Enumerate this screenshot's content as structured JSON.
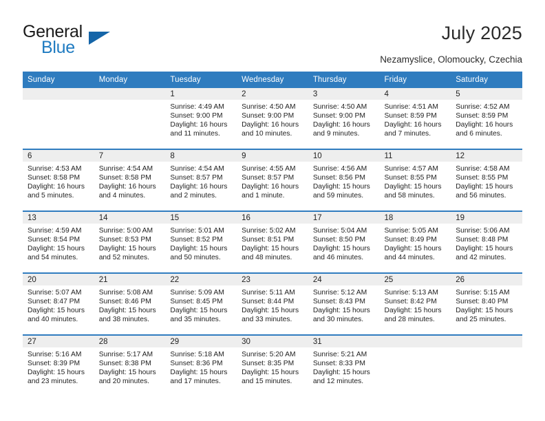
{
  "brand": {
    "word_one": "General",
    "word_two": "Blue",
    "triangle_icon": "brand-triangle-icon",
    "accent_color": "#1f7bc1",
    "triangle_color": "#1565a8"
  },
  "header": {
    "title": "July 2025",
    "subtitle": "Nezamyslice, Olomoucky, Czechia"
  },
  "theme": {
    "header_bg": "#2f7cbf",
    "header_text": "#ffffff",
    "date_strip_bg": "#eeeeee",
    "row_divider": "#2f7cbf",
    "body_text": "#222222"
  },
  "calendar": {
    "weekday_headers": [
      "Sunday",
      "Monday",
      "Tuesday",
      "Wednesday",
      "Thursday",
      "Friday",
      "Saturday"
    ],
    "labels": {
      "sunrise": "Sunrise:",
      "sunset": "Sunset:",
      "daylight": "Daylight:"
    },
    "weeks": [
      [
        {
          "day": "",
          "empty": true
        },
        {
          "day": "",
          "empty": true
        },
        {
          "day": "1",
          "sunrise": "Sunrise: 4:49 AM",
          "sunset": "Sunset: 9:00 PM",
          "daylight_1": "Daylight: 16 hours",
          "daylight_2": "and 11 minutes."
        },
        {
          "day": "2",
          "sunrise": "Sunrise: 4:50 AM",
          "sunset": "Sunset: 9:00 PM",
          "daylight_1": "Daylight: 16 hours",
          "daylight_2": "and 10 minutes."
        },
        {
          "day": "3",
          "sunrise": "Sunrise: 4:50 AM",
          "sunset": "Sunset: 9:00 PM",
          "daylight_1": "Daylight: 16 hours",
          "daylight_2": "and 9 minutes."
        },
        {
          "day": "4",
          "sunrise": "Sunrise: 4:51 AM",
          "sunset": "Sunset: 8:59 PM",
          "daylight_1": "Daylight: 16 hours",
          "daylight_2": "and 7 minutes."
        },
        {
          "day": "5",
          "sunrise": "Sunrise: 4:52 AM",
          "sunset": "Sunset: 8:59 PM",
          "daylight_1": "Daylight: 16 hours",
          "daylight_2": "and 6 minutes."
        }
      ],
      [
        {
          "day": "6",
          "sunrise": "Sunrise: 4:53 AM",
          "sunset": "Sunset: 8:58 PM",
          "daylight_1": "Daylight: 16 hours",
          "daylight_2": "and 5 minutes."
        },
        {
          "day": "7",
          "sunrise": "Sunrise: 4:54 AM",
          "sunset": "Sunset: 8:58 PM",
          "daylight_1": "Daylight: 16 hours",
          "daylight_2": "and 4 minutes."
        },
        {
          "day": "8",
          "sunrise": "Sunrise: 4:54 AM",
          "sunset": "Sunset: 8:57 PM",
          "daylight_1": "Daylight: 16 hours",
          "daylight_2": "and 2 minutes."
        },
        {
          "day": "9",
          "sunrise": "Sunrise: 4:55 AM",
          "sunset": "Sunset: 8:57 PM",
          "daylight_1": "Daylight: 16 hours",
          "daylight_2": "and 1 minute."
        },
        {
          "day": "10",
          "sunrise": "Sunrise: 4:56 AM",
          "sunset": "Sunset: 8:56 PM",
          "daylight_1": "Daylight: 15 hours",
          "daylight_2": "and 59 minutes."
        },
        {
          "day": "11",
          "sunrise": "Sunrise: 4:57 AM",
          "sunset": "Sunset: 8:55 PM",
          "daylight_1": "Daylight: 15 hours",
          "daylight_2": "and 58 minutes."
        },
        {
          "day": "12",
          "sunrise": "Sunrise: 4:58 AM",
          "sunset": "Sunset: 8:55 PM",
          "daylight_1": "Daylight: 15 hours",
          "daylight_2": "and 56 minutes."
        }
      ],
      [
        {
          "day": "13",
          "sunrise": "Sunrise: 4:59 AM",
          "sunset": "Sunset: 8:54 PM",
          "daylight_1": "Daylight: 15 hours",
          "daylight_2": "and 54 minutes."
        },
        {
          "day": "14",
          "sunrise": "Sunrise: 5:00 AM",
          "sunset": "Sunset: 8:53 PM",
          "daylight_1": "Daylight: 15 hours",
          "daylight_2": "and 52 minutes."
        },
        {
          "day": "15",
          "sunrise": "Sunrise: 5:01 AM",
          "sunset": "Sunset: 8:52 PM",
          "daylight_1": "Daylight: 15 hours",
          "daylight_2": "and 50 minutes."
        },
        {
          "day": "16",
          "sunrise": "Sunrise: 5:02 AM",
          "sunset": "Sunset: 8:51 PM",
          "daylight_1": "Daylight: 15 hours",
          "daylight_2": "and 48 minutes."
        },
        {
          "day": "17",
          "sunrise": "Sunrise: 5:04 AM",
          "sunset": "Sunset: 8:50 PM",
          "daylight_1": "Daylight: 15 hours",
          "daylight_2": "and 46 minutes."
        },
        {
          "day": "18",
          "sunrise": "Sunrise: 5:05 AM",
          "sunset": "Sunset: 8:49 PM",
          "daylight_1": "Daylight: 15 hours",
          "daylight_2": "and 44 minutes."
        },
        {
          "day": "19",
          "sunrise": "Sunrise: 5:06 AM",
          "sunset": "Sunset: 8:48 PM",
          "daylight_1": "Daylight: 15 hours",
          "daylight_2": "and 42 minutes."
        }
      ],
      [
        {
          "day": "20",
          "sunrise": "Sunrise: 5:07 AM",
          "sunset": "Sunset: 8:47 PM",
          "daylight_1": "Daylight: 15 hours",
          "daylight_2": "and 40 minutes."
        },
        {
          "day": "21",
          "sunrise": "Sunrise: 5:08 AM",
          "sunset": "Sunset: 8:46 PM",
          "daylight_1": "Daylight: 15 hours",
          "daylight_2": "and 38 minutes."
        },
        {
          "day": "22",
          "sunrise": "Sunrise: 5:09 AM",
          "sunset": "Sunset: 8:45 PM",
          "daylight_1": "Daylight: 15 hours",
          "daylight_2": "and 35 minutes."
        },
        {
          "day": "23",
          "sunrise": "Sunrise: 5:11 AM",
          "sunset": "Sunset: 8:44 PM",
          "daylight_1": "Daylight: 15 hours",
          "daylight_2": "and 33 minutes."
        },
        {
          "day": "24",
          "sunrise": "Sunrise: 5:12 AM",
          "sunset": "Sunset: 8:43 PM",
          "daylight_1": "Daylight: 15 hours",
          "daylight_2": "and 30 minutes."
        },
        {
          "day": "25",
          "sunrise": "Sunrise: 5:13 AM",
          "sunset": "Sunset: 8:42 PM",
          "daylight_1": "Daylight: 15 hours",
          "daylight_2": "and 28 minutes."
        },
        {
          "day": "26",
          "sunrise": "Sunrise: 5:15 AM",
          "sunset": "Sunset: 8:40 PM",
          "daylight_1": "Daylight: 15 hours",
          "daylight_2": "and 25 minutes."
        }
      ],
      [
        {
          "day": "27",
          "sunrise": "Sunrise: 5:16 AM",
          "sunset": "Sunset: 8:39 PM",
          "daylight_1": "Daylight: 15 hours",
          "daylight_2": "and 23 minutes."
        },
        {
          "day": "28",
          "sunrise": "Sunrise: 5:17 AM",
          "sunset": "Sunset: 8:38 PM",
          "daylight_1": "Daylight: 15 hours",
          "daylight_2": "and 20 minutes."
        },
        {
          "day": "29",
          "sunrise": "Sunrise: 5:18 AM",
          "sunset": "Sunset: 8:36 PM",
          "daylight_1": "Daylight: 15 hours",
          "daylight_2": "and 17 minutes."
        },
        {
          "day": "30",
          "sunrise": "Sunrise: 5:20 AM",
          "sunset": "Sunset: 8:35 PM",
          "daylight_1": "Daylight: 15 hours",
          "daylight_2": "and 15 minutes."
        },
        {
          "day": "31",
          "sunrise": "Sunrise: 5:21 AM",
          "sunset": "Sunset: 8:33 PM",
          "daylight_1": "Daylight: 15 hours",
          "daylight_2": "and 12 minutes."
        },
        {
          "day": "",
          "empty": true
        },
        {
          "day": "",
          "empty": true
        }
      ]
    ]
  }
}
